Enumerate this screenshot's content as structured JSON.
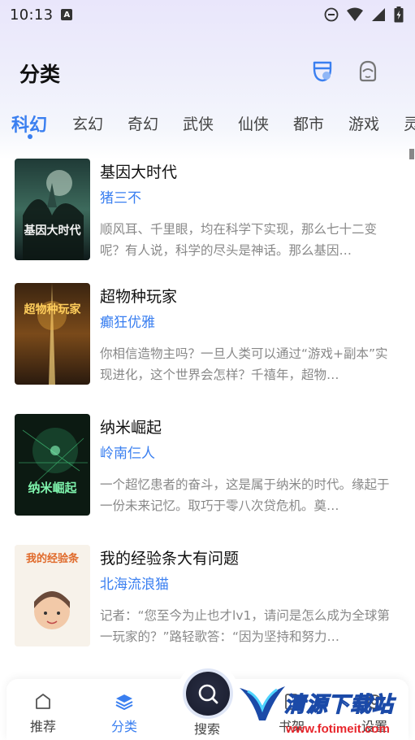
{
  "status_bar": {
    "time": "10:13",
    "notification_icon": "A"
  },
  "header": {
    "title": "分类",
    "accent_color": "#3a7ff0"
  },
  "tabs": [
    {
      "label": "科幻",
      "active": true
    },
    {
      "label": "玄幻"
    },
    {
      "label": "奇幻"
    },
    {
      "label": "武侠"
    },
    {
      "label": "仙侠"
    },
    {
      "label": "都市"
    },
    {
      "label": "游戏"
    },
    {
      "label": "灵"
    }
  ],
  "books": [
    {
      "title": "基因大时代",
      "author": "猪三不",
      "description": "顺风耳、千里眼，均在科学下实现，那么七十二变呢？有人说，科学的尽头是神话。那么基因…",
      "cover_text": "基因大时代"
    },
    {
      "title": "超物种玩家",
      "author": "癫狂优雅",
      "description": "你相信造物主吗？一旦人类可以通过“游戏+副本”实现进化，这个世界会怎样？千禧年，超物…",
      "cover_text": "超物种玩家"
    },
    {
      "title": "纳米崛起",
      "author": "岭南仨人",
      "description": "一个超忆患者的奋斗，这是属于纳米的时代。缘起于一份未来记忆。取巧于零八次贷危机。奠…",
      "cover_text": "纳米崛起"
    },
    {
      "title": "我的经验条大有问题",
      "author": "北海流浪猫",
      "description": "记者：“您至今为止也才lv1，请问是怎么成为全球第一玩家的？”路轻歌答：“因为坚持和努力…",
      "cover_text": "我的经验条"
    }
  ],
  "bottom_nav": {
    "items": [
      {
        "label": "推荐",
        "icon": "home-icon"
      },
      {
        "label": "分类",
        "icon": "layers-icon",
        "active": true
      },
      {
        "label": "搜索",
        "icon": "search-icon"
      },
      {
        "label": "书架",
        "icon": "bookshelf-icon"
      },
      {
        "label": "设置",
        "icon": "settings-icon"
      }
    ]
  },
  "watermark": {
    "text": "清源下载站",
    "url": "www.fotimeit.com"
  }
}
